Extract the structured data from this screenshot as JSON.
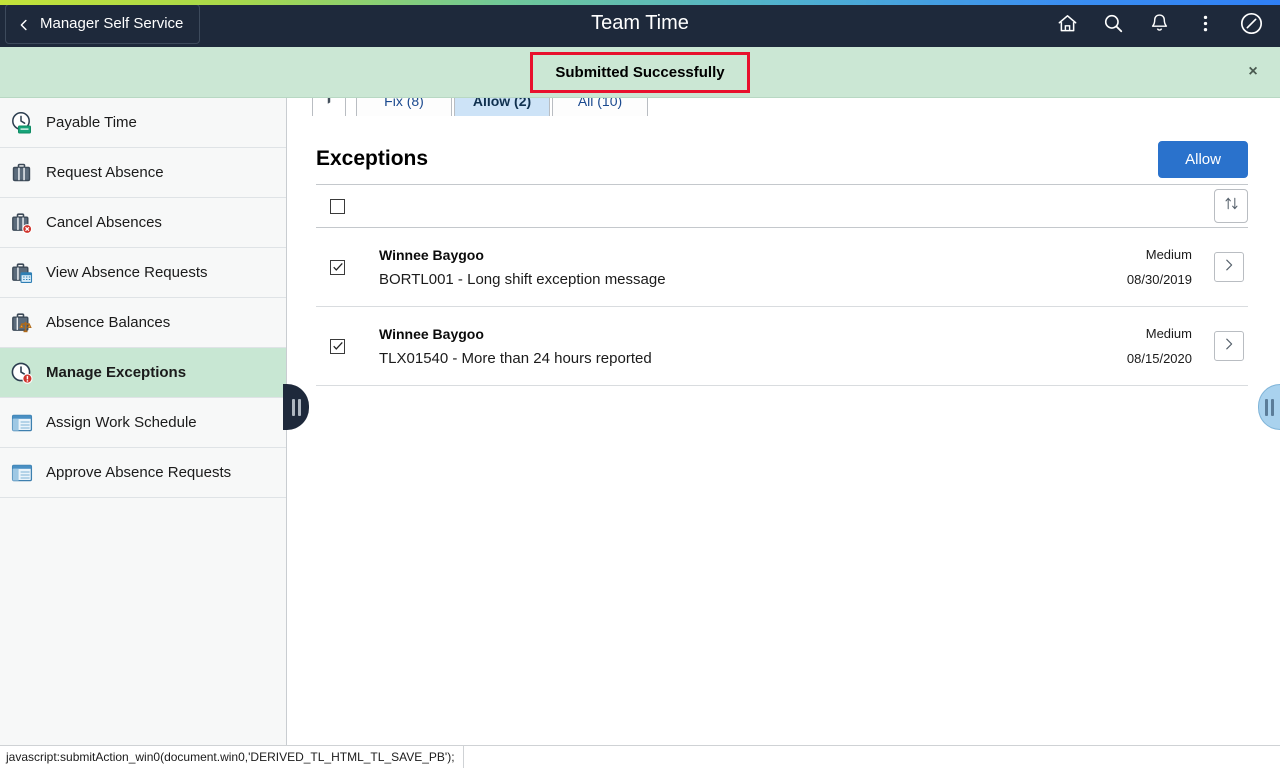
{
  "header": {
    "back_label": "Manager Self Service",
    "back_icon": "chevron-left-icon",
    "title": "Team Time",
    "icons": [
      {
        "name": "home-icon",
        "label": "Home"
      },
      {
        "name": "search-icon",
        "label": "Search"
      },
      {
        "name": "notifications-bell-icon",
        "label": "Notifications"
      },
      {
        "name": "actions-kebab-icon",
        "label": "Actions"
      },
      {
        "name": "navbar-compass-icon",
        "label": "NavBar"
      }
    ],
    "background_color": "#1e293b"
  },
  "progress_strip": {
    "start_color": "#c3e33a",
    "end_color": "#2f7ff5"
  },
  "message_bar": {
    "text": "Submitted Successfully",
    "background_color": "#cbe7d4",
    "highlight_border_color": "#e8112d",
    "close_label": "×"
  },
  "sidebar": {
    "items": [
      {
        "label": "Payable Time",
        "icon": "clock-payable-time-icon",
        "selected": false
      },
      {
        "label": "Request Absence",
        "icon": "briefcase-icon",
        "selected": false
      },
      {
        "label": "Cancel Absences",
        "icon": "briefcase-cancel-icon",
        "selected": false
      },
      {
        "label": "View Absence Requests",
        "icon": "briefcase-calendar-icon",
        "selected": false
      },
      {
        "label": "Absence Balances",
        "icon": "briefcase-balance-icon",
        "selected": false
      },
      {
        "label": "Manage Exceptions",
        "icon": "clock-alert-icon",
        "selected": true
      },
      {
        "label": "Assign Work Schedule",
        "icon": "window-schedule-icon",
        "selected": false
      },
      {
        "label": "Approve Absence Requests",
        "icon": "window-schedule-icon",
        "selected": false
      }
    ],
    "collapse_handle_icon": "pause-bars-handle-icon",
    "selected_background_color": "#c8e7d3"
  },
  "right_panel_handle": {
    "icon": "pause-bars-handle-icon",
    "color": "#a9d2ee"
  },
  "main": {
    "filter_icon": "filter-funnel-icon",
    "tabs": [
      {
        "label": "Fix (8)",
        "active": false
      },
      {
        "label": "Allow (2)",
        "active": true
      },
      {
        "label": "All (10)",
        "active": false
      }
    ],
    "page_title": "Exceptions",
    "allow_button": {
      "label": "Allow",
      "color": "#2a72cc"
    },
    "select_all_checked": false,
    "sort_icon": "sort-up-down-icon",
    "row_chevron_icon": "chevron-right-icon",
    "rows": [
      {
        "checked": true,
        "name": "Winnee Baygoo",
        "description": "BORTL001 - Long shift exception message",
        "severity": "Medium",
        "date": "08/30/2019"
      },
      {
        "checked": true,
        "name": "Winnee Baygoo",
        "description": "TLX01540 - More than 24 hours reported",
        "severity": "Medium",
        "date": "08/15/2020"
      }
    ]
  },
  "status_bar": {
    "text": "javascript:submitAction_win0(document.win0,'DERIVED_TL_HTML_TL_SAVE_PB');"
  }
}
